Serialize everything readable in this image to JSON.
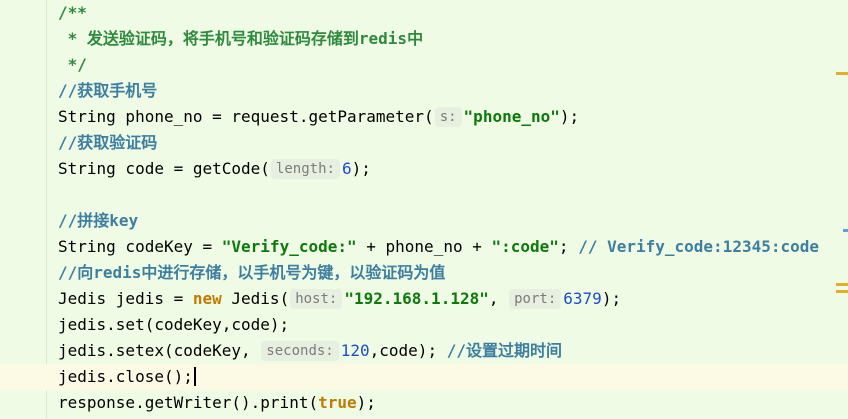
{
  "editor": {
    "lines": [
      {
        "segments": [
          {
            "t": "/**",
            "c": "doc"
          }
        ]
      },
      {
        "segments": [
          {
            "t": " * 发送验证码，将手机号和验证码存储到redis中",
            "c": "doc"
          }
        ]
      },
      {
        "segments": [
          {
            "t": " */",
            "c": "doc"
          }
        ]
      },
      {
        "segments": [
          {
            "t": "//获取手机号",
            "c": "comment"
          }
        ]
      },
      {
        "segments": [
          {
            "t": "String phone_no = request.getParameter(",
            "c": "plain"
          },
          {
            "t": "s:",
            "c": "hint"
          },
          {
            "t": "\"phone_no\"",
            "c": "string"
          },
          {
            "t": ");",
            "c": "plain"
          }
        ]
      },
      {
        "segments": [
          {
            "t": "//获取验证码",
            "c": "comment"
          }
        ]
      },
      {
        "segments": [
          {
            "t": "String code = getCode(",
            "c": "plain"
          },
          {
            "t": "length:",
            "c": "hint"
          },
          {
            "t": "6",
            "c": "number"
          },
          {
            "t": ");",
            "c": "plain"
          }
        ]
      },
      {
        "segments": []
      },
      {
        "segments": [
          {
            "t": "//拼接key",
            "c": "comment"
          }
        ]
      },
      {
        "segments": [
          {
            "t": "String codeKey = ",
            "c": "plain"
          },
          {
            "t": "\"Verify_code:\"",
            "c": "string"
          },
          {
            "t": " + phone_no + ",
            "c": "plain"
          },
          {
            "t": "\":code\"",
            "c": "string"
          },
          {
            "t": "; ",
            "c": "plain"
          },
          {
            "t": "// Verify_code:12345:code",
            "c": "comment"
          }
        ]
      },
      {
        "segments": [
          {
            "t": "//向redis中进行存储，以手机号为键，以验证码为值",
            "c": "comment"
          }
        ]
      },
      {
        "segments": [
          {
            "t": "Jedis jedis = ",
            "c": "plain"
          },
          {
            "t": "new",
            "c": "keyword"
          },
          {
            "t": " Jedis(",
            "c": "plain"
          },
          {
            "t": "host:",
            "c": "hint"
          },
          {
            "t": "\"192.168.1.128\"",
            "c": "string"
          },
          {
            "t": ", ",
            "c": "plain"
          },
          {
            "t": "port:",
            "c": "hint"
          },
          {
            "t": "6379",
            "c": "number"
          },
          {
            "t": ");",
            "c": "plain"
          }
        ]
      },
      {
        "segments": [
          {
            "t": "jedis.set(codeKey,code);",
            "c": "plain"
          }
        ]
      },
      {
        "segments": [
          {
            "t": "jedis.setex(codeKey, ",
            "c": "plain"
          },
          {
            "t": "seconds:",
            "c": "hint"
          },
          {
            "t": "120",
            "c": "number"
          },
          {
            "t": ",code); ",
            "c": "plain"
          },
          {
            "t": "//设置过期时间",
            "c": "comment"
          }
        ]
      },
      {
        "segments": [
          {
            "t": "jedis.close();",
            "c": "plain"
          }
        ],
        "current": true
      },
      {
        "segments": [
          {
            "t": "response.getWriter().print(",
            "c": "plain"
          },
          {
            "t": "true",
            "c": "keyword"
          },
          {
            "t": ");",
            "c": "plain"
          }
        ]
      }
    ]
  },
  "colors": {
    "background": "#f0fbe6",
    "current_line": "#fcf9e4",
    "comment": "#3c7fa0",
    "doc_comment": "#2e8a3c",
    "string": "#0b7a0b",
    "keyword": "#c27a00",
    "number": "#1b4fc9",
    "hint_bg": "#e7efe1",
    "hint_text": "#7c7c7c",
    "marker": "#e0b126"
  }
}
